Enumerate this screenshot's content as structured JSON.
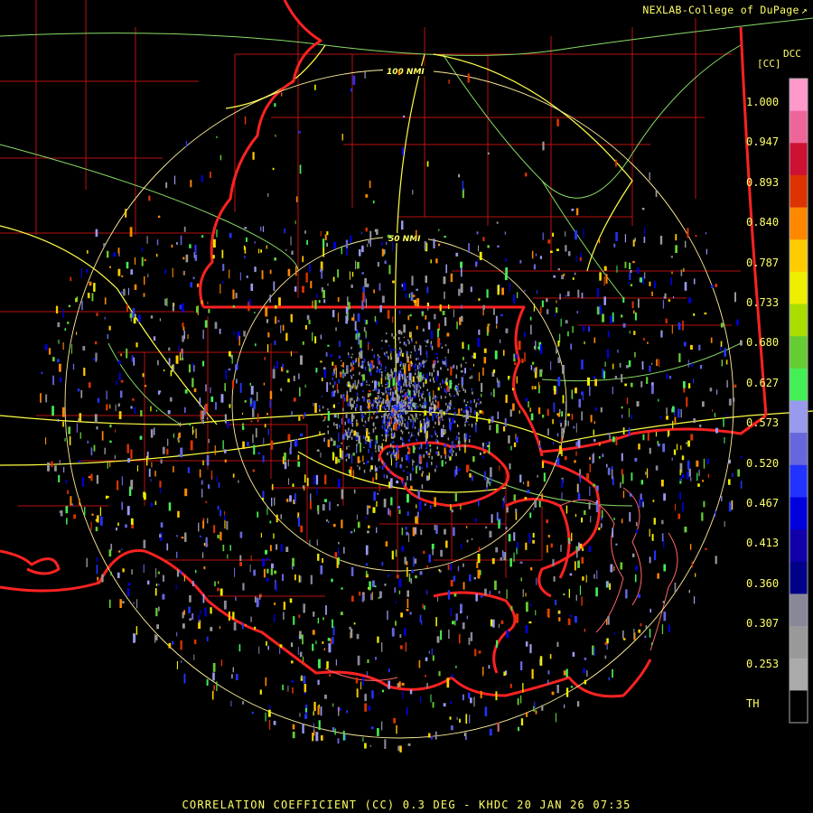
{
  "header": {
    "credit": "NEXLAB-College of DuPage"
  },
  "legend": {
    "product": "DCC",
    "units": "[CC]",
    "ticks": [
      "1.000",
      "0.947",
      "0.893",
      "0.840",
      "0.787",
      "0.733",
      "0.680",
      "0.627",
      "0.573",
      "0.520",
      "0.467",
      "0.413",
      "0.360",
      "0.307",
      "0.253",
      "TH"
    ],
    "colors": [
      "#ff99cc",
      "#ee6699",
      "#cc1133",
      "#dd3300",
      "#ff8800",
      "#ffcc00",
      "#eeee00",
      "#aadd00",
      "#66cc33",
      "#44ee55",
      "#9999ee",
      "#6666dd",
      "#2233ff",
      "#0000dd",
      "#1100aa",
      "#000088",
      "#888899",
      "#999999",
      "#aaaaaa",
      "#000000"
    ]
  },
  "range_rings": {
    "inner_label": "50 NMI",
    "outer_label": "100 NMI"
  },
  "footer": {
    "caption": "CORRELATION COEFFICIENT (CC) 0.3 DEG - KHDC 20 JAN 26 07:35"
  },
  "map_colors": {
    "state_border": "#ff2222",
    "county_border": "#bb1111",
    "highway": "#ffff44",
    "road": "#88dd66",
    "ring": "#ffee99"
  }
}
